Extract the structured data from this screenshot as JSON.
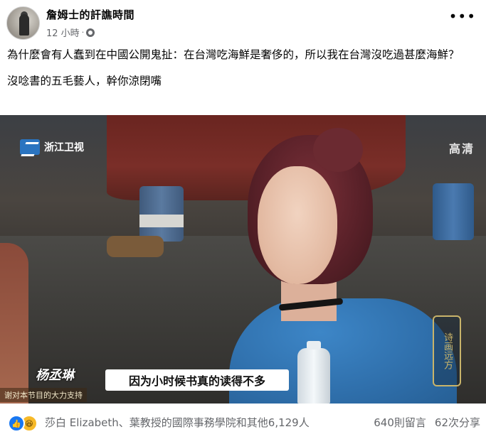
{
  "post": {
    "author": "詹姆士的訐譙時間",
    "timestamp": "12 小時",
    "separator": "·",
    "paragraphs": [
      "為什麼會有人蠢到在中國公開鬼扯：在台灣吃海鮮是奢侈的，所以我在台灣沒吃過甚麼海鮮？",
      "沒唸書的五毛藝人，幹你涼閉嘴"
    ],
    "more_icon": "more-horizontal-icon",
    "privacy_icon": "globe-icon"
  },
  "video": {
    "station_name": "浙江卫视",
    "quality_badge": "高清",
    "show_logo": "诗画远方",
    "speaker_name": "杨丞琳",
    "subtitle": "因为小时候书真的读得不多",
    "ticker": "谢对本节目的大力支持"
  },
  "footer": {
    "reaction_icons": [
      "like-icon",
      "haha-icon"
    ],
    "reactors": "莎白 Elizabeth、葉教授的國際事務學院和其他6,129人",
    "comments": "640則留言",
    "shares": "62次分享"
  }
}
